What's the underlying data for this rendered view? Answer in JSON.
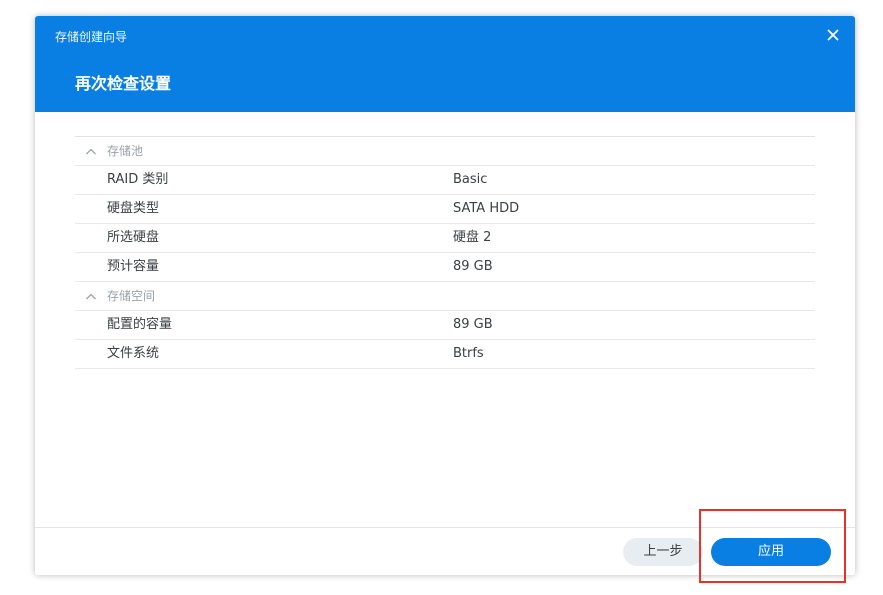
{
  "dialog": {
    "wizard_title": "存储创建向导",
    "page_title": "再次检查设置",
    "close_icon": "close-icon"
  },
  "sections": [
    {
      "title": "存储池",
      "rows": [
        {
          "label": "RAID 类别",
          "value": "Basic"
        },
        {
          "label": "硬盘类型",
          "value": "SATA HDD"
        },
        {
          "label": "所选硬盘",
          "value": "硬盘 2"
        },
        {
          "label": "预计容量",
          "value": "89 GB"
        }
      ]
    },
    {
      "title": "存储空间",
      "rows": [
        {
          "label": "配置的容量",
          "value": "89 GB"
        },
        {
          "label": "文件系统",
          "value": "Btrfs"
        }
      ]
    }
  ],
  "footer": {
    "prev_label": "上一步",
    "apply_label": "应用"
  },
  "colors": {
    "accent": "#0a7fe3",
    "highlight": "#e8312b"
  }
}
